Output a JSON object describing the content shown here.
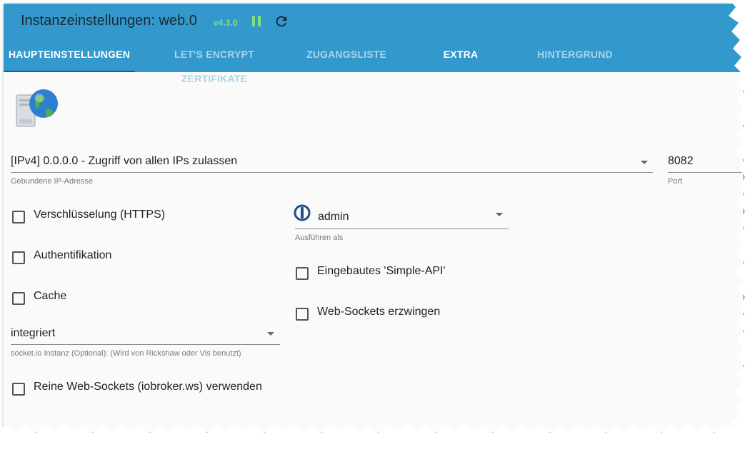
{
  "header": {
    "title": "Instanzeinstellungen: web.0",
    "version": "v4.3.0",
    "tabs": [
      {
        "label": "HAUPTEINSTELLUNGEN"
      },
      {
        "label": "LET'S ENCRYPT ZERTIFIKATE"
      },
      {
        "label": "ZUGANGSLISTE"
      },
      {
        "label": "EXTRA"
      },
      {
        "label": "HINTERGRUND"
      }
    ]
  },
  "colors": {
    "header_bg": "#3399cc",
    "status_green": "#7ee07e"
  },
  "form": {
    "bind_ip": {
      "value": "[IPv4] 0.0.0.0 - Zugriff von allen IPs zulassen",
      "helper": "Gebundene IP-Adresse"
    },
    "port": {
      "value": "8082",
      "helper": "Port"
    },
    "run_as": {
      "value": "admin",
      "helper": "Ausführen als"
    },
    "socketio": {
      "value": "integriert",
      "helper": "socket.io Instanz (Optional): (Wird von Rickshaw oder Vis benutzt)"
    },
    "checkboxes": {
      "https": {
        "label": "Verschlüsselung (HTTPS)",
        "checked": false
      },
      "auth": {
        "label": "Authentifikation",
        "checked": false
      },
      "cache": {
        "label": "Cache",
        "checked": false
      },
      "simple_api": {
        "label": "Eingebautes 'Simple-API'",
        "checked": false
      },
      "force_ws": {
        "label": "Web-Sockets erzwingen",
        "checked": false
      },
      "pure_ws": {
        "label": "Reine Web-Sockets (iobroker.ws) verwenden",
        "checked": false
      }
    }
  },
  "icons": {
    "logo": "server-globe-icon",
    "pause": "pause-icon",
    "reload": "reload-icon",
    "admin": "iobroker-admin-icon"
  }
}
